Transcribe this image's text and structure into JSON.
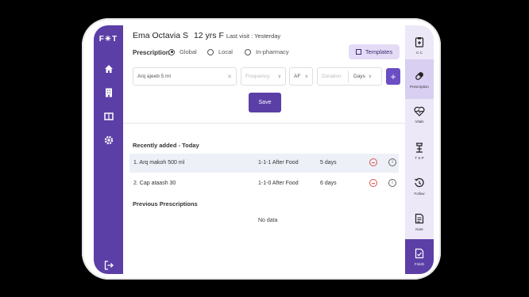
{
  "app": {
    "logo": "F✴T"
  },
  "patient": {
    "name": "Ema Octavia S",
    "age": "12 yrs F",
    "last_visit": "Last visit : Yesterday"
  },
  "prescription": {
    "label": "Prescription",
    "options": [
      {
        "label": "Global",
        "selected": true
      },
      {
        "label": "Local",
        "selected": false
      },
      {
        "label": "In-pharmacy",
        "selected": false
      }
    ],
    "templates_label": "Templates",
    "form": {
      "medicine_value": "Arq ajeeb 5 ml",
      "frequency_placeholder": "Frequency",
      "timing_value": "AF",
      "duration_placeholder": "Duration",
      "duration_unit": "Days"
    },
    "add_label": "+",
    "save_label": "Save"
  },
  "recent": {
    "title": "Recently added - Today",
    "rows": [
      {
        "name": "1. Arq makoh 500 ml",
        "dose": "1-1-1  After Food",
        "duration": "5 days"
      },
      {
        "name": "2. Cap ataash 30",
        "dose": "1-1-0  After Food",
        "duration": "6 days"
      }
    ]
  },
  "previous": {
    "title": "Previous Prescriptions",
    "empty_text": "No data"
  },
  "right_nav": {
    "items": [
      {
        "label": "C C",
        "icon": "clipboard-icon"
      },
      {
        "label": "Prescription",
        "icon": "pill-icon"
      },
      {
        "label": "Vitals",
        "icon": "heart-pulse-icon"
      },
      {
        "label": "T S P",
        "icon": "stand-icon"
      },
      {
        "label": "Follow",
        "icon": "history-icon"
      },
      {
        "label": "Note",
        "icon": "note-icon"
      },
      {
        "label": "Finish",
        "icon": "finish-icon"
      }
    ]
  },
  "colors": {
    "primary": "#5b3fa6",
    "accent": "#6b4ec4",
    "light": "#ece8f8",
    "danger": "#d9534f"
  }
}
